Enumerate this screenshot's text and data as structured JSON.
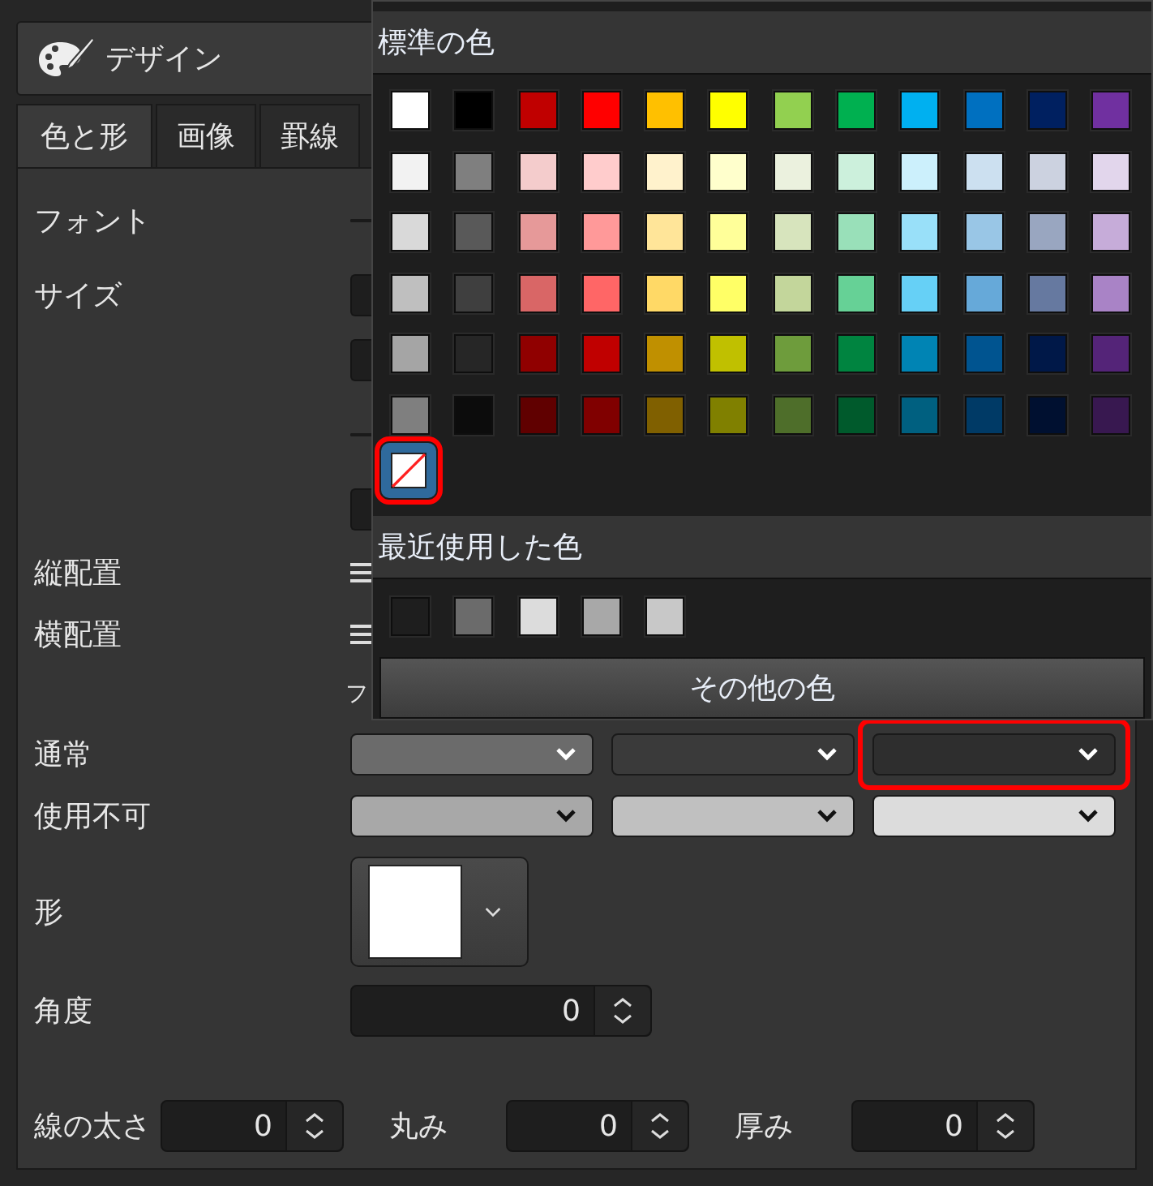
{
  "header": {
    "title": "デザイン"
  },
  "tabs": [
    {
      "label": "色と形",
      "selected": true
    },
    {
      "label": "画像",
      "selected": false
    },
    {
      "label": "罫線",
      "selected": false
    }
  ],
  "rows": [
    {
      "kind": "button",
      "label": "フォント"
    },
    {
      "kind": "field",
      "label": "サイズ"
    },
    {
      "kind": "field"
    },
    {
      "kind": "button"
    },
    {
      "kind": "field"
    },
    {
      "kind": "align",
      "label": "縦配置"
    },
    {
      "kind": "align",
      "label": "横配置"
    },
    {
      "kind": "text",
      "text": "フ"
    },
    {
      "kind": "dropdowns",
      "label": "通常",
      "dropdowns": [
        {
          "color": "#6b6b6b",
          "highlighted": false
        },
        {
          "color": "#3a3a3a",
          "highlighted": false
        },
        {
          "color": "#2e2e2e",
          "highlighted": true
        }
      ]
    },
    {
      "kind": "dropdowns",
      "label": "使用不可",
      "dropdowns": [
        {
          "color": "#a8a8a8",
          "highlighted": false
        },
        {
          "color": "#c0c0c0",
          "highlighted": false
        },
        {
          "color": "#dcdcdc",
          "highlighted": false
        }
      ]
    },
    {
      "kind": "shape",
      "label": "形",
      "color": "#ffffff"
    },
    {
      "kind": "spin",
      "label": "角度",
      "value": "0"
    }
  ],
  "bottom_spinners": [
    {
      "label": "線の太さ",
      "value": "0"
    },
    {
      "label": "丸み",
      "value": "0"
    },
    {
      "label": "厚み",
      "value": "0"
    }
  ],
  "color_popup": {
    "standard_title": "標準の色",
    "swatch_rows": [
      [
        {
          "color": "#ffffff"
        },
        {
          "color": "#000000"
        },
        {
          "color": "#c00000"
        },
        {
          "color": "#ff0000"
        },
        {
          "color": "#ffc000"
        },
        {
          "color": "#ffff00"
        },
        {
          "color": "#92d050"
        },
        {
          "color": "#00b050"
        },
        {
          "color": "#00b0f0"
        },
        {
          "color": "#0070c0"
        },
        {
          "color": "#002060"
        },
        {
          "color": "#7030a0"
        }
      ],
      [
        {
          "color": "#f2f2f2"
        },
        {
          "color": "#7f7f7f"
        },
        {
          "color": "#f4cccc"
        },
        {
          "color": "#ffcccc"
        },
        {
          "color": "#fff2cc"
        },
        {
          "color": "#ffffcc"
        },
        {
          "color": "#ebf1de"
        },
        {
          "color": "#ccf0dc"
        },
        {
          "color": "#ccf0fc"
        },
        {
          "color": "#cce0f0"
        },
        {
          "color": "#ccd2e0"
        },
        {
          "color": "#e2d6ec"
        }
      ],
      [
        {
          "color": "#d9d9d9"
        },
        {
          "color": "#595959"
        },
        {
          "color": "#e69999"
        },
        {
          "color": "#ff9999"
        },
        {
          "color": "#ffe599"
        },
        {
          "color": "#ffff99"
        },
        {
          "color": "#d7e4bd"
        },
        {
          "color": "#99e0b9"
        },
        {
          "color": "#99e0f9"
        },
        {
          "color": "#99c6e6"
        },
        {
          "color": "#99a6c0"
        },
        {
          "color": "#c6acd9"
        }
      ],
      [
        {
          "color": "#bfbfbf"
        },
        {
          "color": "#3f3f3f"
        },
        {
          "color": "#d96666"
        },
        {
          "color": "#ff6666"
        },
        {
          "color": "#ffd966"
        },
        {
          "color": "#ffff66"
        },
        {
          "color": "#c3d69b"
        },
        {
          "color": "#66d196"
        },
        {
          "color": "#66d0f6"
        },
        {
          "color": "#66a9d9"
        },
        {
          "color": "#6679a0"
        },
        {
          "color": "#a983c6"
        }
      ],
      [
        {
          "color": "#a5a5a5"
        },
        {
          "color": "#262626"
        },
        {
          "color": "#900000"
        },
        {
          "color": "#c00000"
        },
        {
          "color": "#c09000"
        },
        {
          "color": "#c0c000"
        },
        {
          "color": "#6e9c3c"
        },
        {
          "color": "#008440"
        },
        {
          "color": "#0084b4"
        },
        {
          "color": "#005490"
        },
        {
          "color": "#001848"
        },
        {
          "color": "#542478"
        }
      ],
      [
        {
          "color": "#7f7f7f"
        },
        {
          "color": "#0c0c0c"
        },
        {
          "color": "#600000"
        },
        {
          "color": "#800000"
        },
        {
          "color": "#806000"
        },
        {
          "color": "#808000"
        },
        {
          "color": "#4e6e2a"
        },
        {
          "color": "#005a2c"
        },
        {
          "color": "#006080"
        },
        {
          "color": "#003a66"
        },
        {
          "color": "#001030"
        },
        {
          "color": "#381850"
        }
      ]
    ],
    "no_color": {
      "selected": true,
      "highlighted": true
    },
    "recent_title": "最近使用した色",
    "recent": [
      {
        "color": "#1e1e1e"
      },
      {
        "color": "#6b6b6b"
      },
      {
        "color": "#dcdcdc"
      },
      {
        "color": "#a8a8a8"
      },
      {
        "color": "#c8c8c8"
      }
    ],
    "more_button": "その他の色"
  }
}
